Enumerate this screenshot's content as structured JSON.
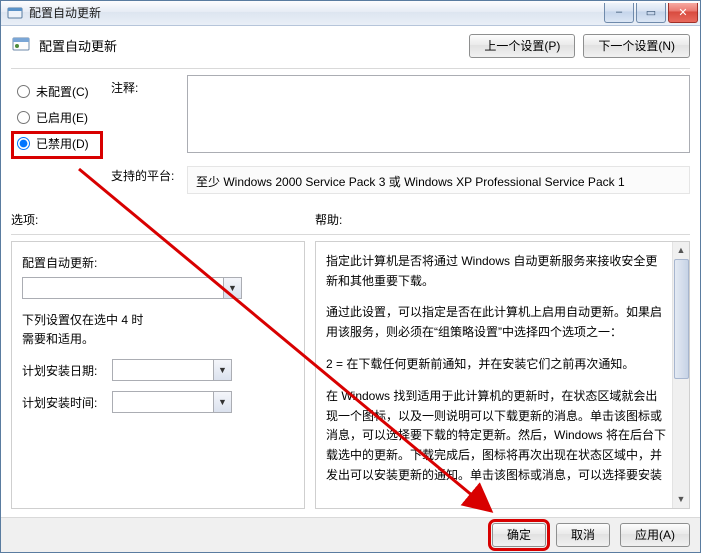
{
  "window": {
    "title": "配置自动更新",
    "min_label": "–",
    "max_label": "▭",
    "close_label": "✕"
  },
  "header": {
    "title": "配置自动更新",
    "prev_btn": "上一个设置(P)",
    "next_btn": "下一个设置(N)"
  },
  "radios": {
    "not_configured": "未配置(C)",
    "enabled": "已启用(E)",
    "disabled": "已禁用(D)"
  },
  "labels": {
    "comment": "注释:",
    "platform": "支持的平台:",
    "options": "选项:",
    "help": "帮助:"
  },
  "platform_value": "至少 Windows 2000 Service Pack 3 或 Windows XP Professional Service Pack 1",
  "options": {
    "auto_update_label": "配置自动更新:",
    "note_line1": "下列设置仅在选中 4 时",
    "note_line2": "需要和适用。",
    "install_day_label": "计划安装日期:",
    "install_time_label": "计划安装时间:",
    "dd_arrow": "▼"
  },
  "help": {
    "p1": "指定此计算机是否将通过 Windows 自动更新服务来接收安全更新和其他重要下载。",
    "p2": "通过此设置，可以指定是否在此计算机上启用自动更新。如果启用该服务，则必须在“组策略设置”中选择四个选项之一：",
    "p3": "2 = 在下载任何更新前通知，并在安装它们之前再次通知。",
    "p4": "在 Windows 找到适用于此计算机的更新时，在状态区域就会出现一个图标，以及一则说明可以下载更新的消息。单击该图标或消息，可以选择要下载的特定更新。然后，Windows 将在后台下载选中的更新。下载完成后，图标将再次出现在状态区域中，并发出可以安装更新的通知。单击该图标或消息，可以选择要安装"
  },
  "footer": {
    "ok": "确定",
    "cancel": "取消",
    "apply": "应用(A)"
  }
}
